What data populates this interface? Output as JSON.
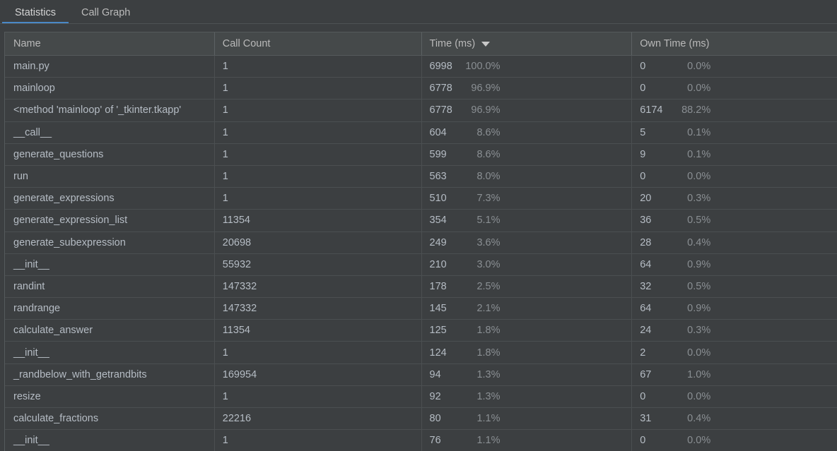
{
  "tabs": [
    {
      "label": "Statistics",
      "active": true
    },
    {
      "label": "Call Graph",
      "active": false
    }
  ],
  "accent_color": "#4a88c7",
  "background_color": "#3c3f41",
  "table": {
    "columns": [
      {
        "label": "Name",
        "sorted": false
      },
      {
        "label": "Call Count",
        "sorted": false
      },
      {
        "label": "Time (ms)",
        "sorted": true,
        "sort_direction": "descending",
        "sort_icon": "chevron-down-icon"
      },
      {
        "label": "Own Time (ms)",
        "sorted": false
      }
    ],
    "rows": [
      {
        "name": "main.py",
        "call_count": "1",
        "time": "6998",
        "time_pct": "100.0%",
        "own_time": "0",
        "own_pct": "0.0%"
      },
      {
        "name": "mainloop",
        "call_count": "1",
        "time": "6778",
        "time_pct": "96.9%",
        "own_time": "0",
        "own_pct": "0.0%"
      },
      {
        "name": "<method 'mainloop' of '_tkinter.tkapp'",
        "call_count": "1",
        "time": "6778",
        "time_pct": "96.9%",
        "own_time": "6174",
        "own_pct": "88.2%"
      },
      {
        "name": "__call__",
        "call_count": "1",
        "time": "604",
        "time_pct": "8.6%",
        "own_time": "5",
        "own_pct": "0.1%"
      },
      {
        "name": "generate_questions",
        "call_count": "1",
        "time": "599",
        "time_pct": "8.6%",
        "own_time": "9",
        "own_pct": "0.1%"
      },
      {
        "name": "run",
        "call_count": "1",
        "time": "563",
        "time_pct": "8.0%",
        "own_time": "0",
        "own_pct": "0.0%"
      },
      {
        "name": "generate_expressions",
        "call_count": "1",
        "time": "510",
        "time_pct": "7.3%",
        "own_time": "20",
        "own_pct": "0.3%"
      },
      {
        "name": "generate_expression_list",
        "call_count": "11354",
        "time": "354",
        "time_pct": "5.1%",
        "own_time": "36",
        "own_pct": "0.5%"
      },
      {
        "name": "generate_subexpression",
        "call_count": "20698",
        "time": "249",
        "time_pct": "3.6%",
        "own_time": "28",
        "own_pct": "0.4%"
      },
      {
        "name": "__init__",
        "call_count": "55932",
        "time": "210",
        "time_pct": "3.0%",
        "own_time": "64",
        "own_pct": "0.9%"
      },
      {
        "name": "randint",
        "call_count": "147332",
        "time": "178",
        "time_pct": "2.5%",
        "own_time": "32",
        "own_pct": "0.5%"
      },
      {
        "name": "randrange",
        "call_count": "147332",
        "time": "145",
        "time_pct": "2.1%",
        "own_time": "64",
        "own_pct": "0.9%"
      },
      {
        "name": "calculate_answer",
        "call_count": "11354",
        "time": "125",
        "time_pct": "1.8%",
        "own_time": "24",
        "own_pct": "0.3%"
      },
      {
        "name": "__init__",
        "call_count": "1",
        "time": "124",
        "time_pct": "1.8%",
        "own_time": "2",
        "own_pct": "0.0%"
      },
      {
        "name": "_randbelow_with_getrandbits",
        "call_count": "169954",
        "time": "94",
        "time_pct": "1.3%",
        "own_time": "67",
        "own_pct": "1.0%"
      },
      {
        "name": "resize",
        "call_count": "1",
        "time": "92",
        "time_pct": "1.3%",
        "own_time": "0",
        "own_pct": "0.0%"
      },
      {
        "name": "calculate_fractions",
        "call_count": "22216",
        "time": "80",
        "time_pct": "1.1%",
        "own_time": "31",
        "own_pct": "0.4%"
      },
      {
        "name": "__init__",
        "call_count": "1",
        "time": "76",
        "time_pct": "1.1%",
        "own_time": "0",
        "own_pct": "0.0%"
      }
    ]
  }
}
